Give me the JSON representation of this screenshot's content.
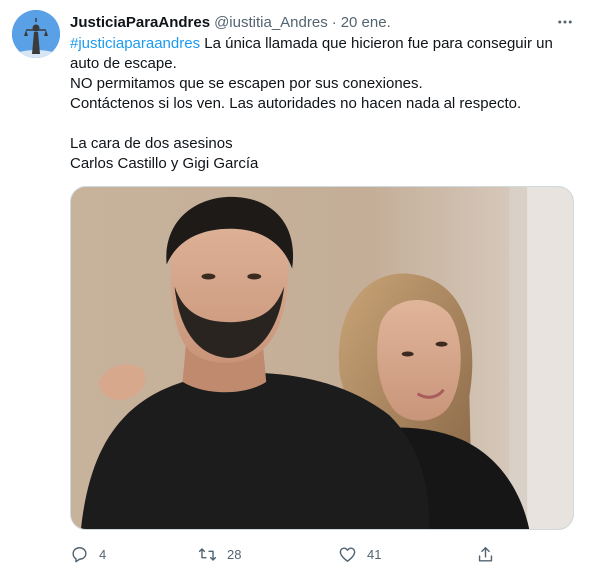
{
  "tweet": {
    "display_name": "JusticiaParaAndres",
    "handle": "@iustitia_Andres",
    "separator": "·",
    "date": "20 ene.",
    "hashtag": "#justiciaparaandres",
    "line1_rest": " La única llamada que hicieron fue para conseguir un auto de escape.",
    "line2": "NO permitamos que se escapen por sus conexiones.",
    "line3": "Contáctenos si los ven. Las autoridades no hacen nada al respecto.",
    "line4": "La cara de dos asesinos",
    "line5": "Carlos Castillo y Gigi García"
  },
  "actions": {
    "replies": "4",
    "retweets": "28",
    "likes": "41"
  },
  "icons": {
    "more": "more-icon",
    "reply": "reply-icon",
    "retweet": "retweet-icon",
    "like": "heart-icon",
    "share": "share-icon"
  },
  "colors": {
    "link": "#1d9bf0",
    "secondary_text": "#536471",
    "primary_text": "#0f1419"
  }
}
